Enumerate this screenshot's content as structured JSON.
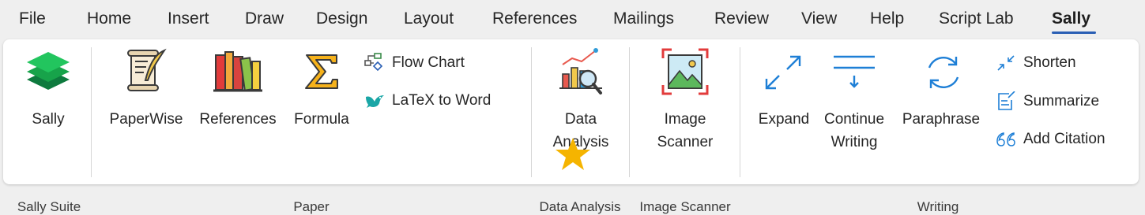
{
  "tabs": [
    "File",
    "Home",
    "Insert",
    "Draw",
    "Design",
    "Layout",
    "References",
    "Mailings",
    "Review",
    "View",
    "Help",
    "Script Lab",
    "Sally"
  ],
  "active_tab": "Sally",
  "accent_color": "#2a5fb4",
  "groups": {
    "sally_suite": {
      "label": "Sally Suite",
      "sally_button": {
        "label": "Sally",
        "icon": "sally-layers-icon"
      }
    },
    "paper": {
      "label": "Paper",
      "paperwise": {
        "label": "PaperWise",
        "icon": "scroll-quill-icon"
      },
      "references": {
        "label": "References",
        "icon": "books-icon"
      },
      "formula": {
        "label": "Formula",
        "icon": "sigma-icon"
      },
      "flow_chart": {
        "label": "Flow Chart",
        "icon": "flow-chart-icon"
      },
      "latex_to_word": {
        "label": "LaTeX to Word",
        "icon": "bird-icon"
      }
    },
    "data_analysis": {
      "label": "Data Analysis",
      "data_analysis_button": {
        "label_line1": "Data",
        "label_line2": "Analysis",
        "icon": "chart-magnifier-icon"
      }
    },
    "image_scanner": {
      "label": "Image Scanner",
      "image_scanner_button": {
        "label_line1": "Image",
        "label_line2": "Scanner",
        "icon": "image-scan-icon"
      }
    },
    "writing": {
      "label": "Writing",
      "expand": {
        "label": "Expand",
        "icon": "expand-arrows-icon"
      },
      "continue_writing": {
        "label_line1": "Continue",
        "label_line2": "Writing",
        "icon": "continue-lines-icon"
      },
      "paraphrase": {
        "label": "Paraphrase",
        "icon": "refresh-icon"
      },
      "shorten": {
        "label": "Shorten",
        "icon": "shrink-arrows-icon"
      },
      "summarize": {
        "label": "Summarize",
        "icon": "summary-note-icon"
      },
      "add_citation": {
        "label": "Add Citation",
        "icon": "quote-icon"
      }
    }
  },
  "marker": {
    "icon": "star-icon",
    "color": "#f5b400"
  }
}
